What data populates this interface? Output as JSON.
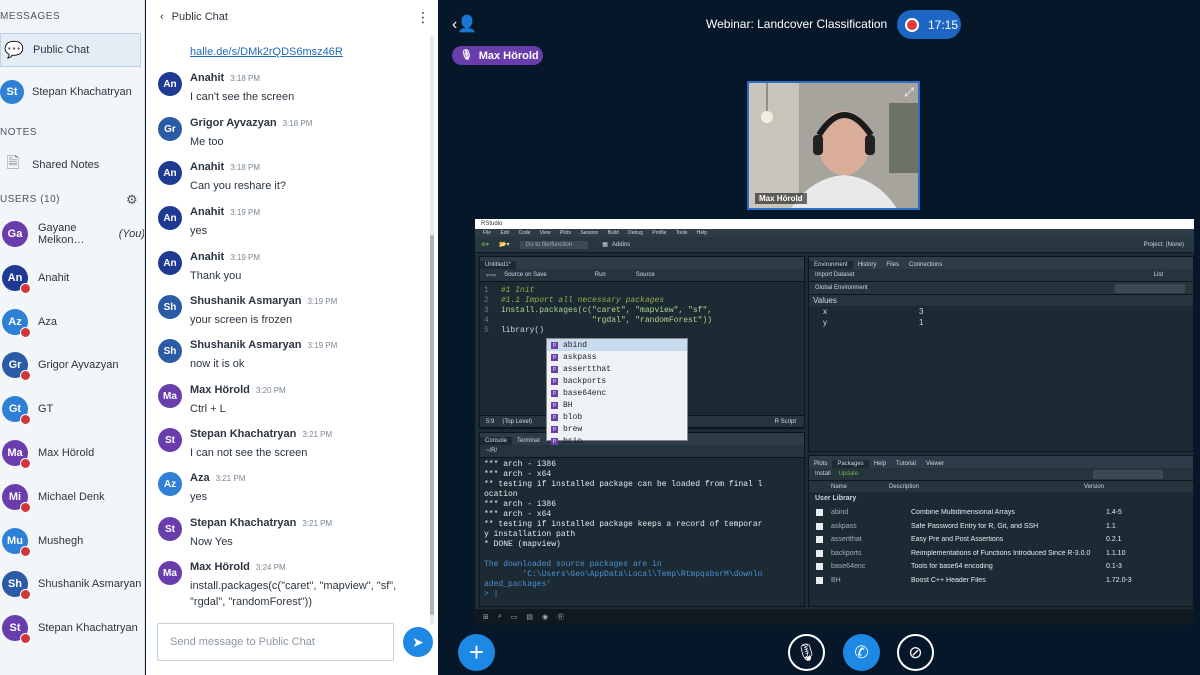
{
  "sidebar": {
    "messages_header": "MESSAGES",
    "public_chat": "Public Chat",
    "private_chat_initials": "St",
    "private_chat_name": "Stepan Khachatryan",
    "notes_header": "NOTES",
    "shared_notes": "Shared Notes",
    "users_header": "USERS (10)",
    "users": [
      {
        "initials": "Ga",
        "name": "Gayane Melkon…",
        "suffix": "(You)",
        "color": "#6a3dad"
      },
      {
        "initials": "An",
        "name": "Anahit",
        "suffix": "",
        "color": "#1f3a93"
      },
      {
        "initials": "Az",
        "name": "Aza",
        "suffix": "",
        "color": "#2e7fd6"
      },
      {
        "initials": "Gr",
        "name": "Grigor Ayvazyan",
        "suffix": "",
        "color": "#2b5aa6"
      },
      {
        "initials": "Gt",
        "name": "GT",
        "suffix": "",
        "color": "#2e7fd6"
      },
      {
        "initials": "Ma",
        "name": "Max Hörold",
        "suffix": "",
        "color": "#6a3dad"
      },
      {
        "initials": "Mi",
        "name": "Michael Denk",
        "suffix": "",
        "color": "#6a3dad"
      },
      {
        "initials": "Mu",
        "name": "Mushegh",
        "suffix": "",
        "color": "#2e7fd6"
      },
      {
        "initials": "Sh",
        "name": "Shushanik Asmaryan",
        "suffix": "",
        "color": "#2b5aa6"
      },
      {
        "initials": "St",
        "name": "Stepan Khachatryan",
        "suffix": "",
        "color": "#6a3dad"
      }
    ]
  },
  "chat": {
    "title": "Public Chat",
    "link": "halle.de/s/DMk2rQDS6msz46R",
    "messages": [
      {
        "initials": "An",
        "name": "Anahit",
        "time": "3:18 PM",
        "lines": [
          "I can't see the screen"
        ],
        "color": "#1f3a93"
      },
      {
        "initials": "Gr",
        "name": "Grigor Ayvazyan",
        "time": "3:18 PM",
        "lines": [
          "Me too"
        ],
        "color": "#2b5aa6"
      },
      {
        "initials": "An",
        "name": "Anahit",
        "time": "3:18 PM",
        "lines": [
          "Can you reshare it?"
        ],
        "color": "#1f3a93"
      },
      {
        "initials": "An",
        "name": "Anahit",
        "time": "3:19 PM",
        "lines": [
          "yes"
        ],
        "color": "#1f3a93"
      },
      {
        "initials": "An",
        "name": "Anahit",
        "time": "3:19 PM",
        "lines": [
          "Thank you"
        ],
        "color": "#1f3a93"
      },
      {
        "initials": "Sh",
        "name": "Shushanik Asmaryan",
        "time": "3:19 PM",
        "lines": [
          "your screen is frozen"
        ],
        "color": "#2b5aa6"
      },
      {
        "initials": "Sh",
        "name": "Shushanik Asmaryan",
        "time": "3:19 PM",
        "lines": [
          "now it is ok"
        ],
        "color": "#2b5aa6"
      },
      {
        "initials": "Ma",
        "name": "Max Hörold",
        "time": "3:20 PM",
        "lines": [
          "Ctrl + L"
        ],
        "color": "#6a3dad"
      },
      {
        "initials": "St",
        "name": "Stepan Khachatryan",
        "time": "3:21 PM",
        "lines": [
          "I can not see the screen"
        ],
        "color": "#6a3dad"
      },
      {
        "initials": "Az",
        "name": "Aza",
        "time": "3:21 PM",
        "lines": [
          "yes"
        ],
        "color": "#2e7fd6"
      },
      {
        "initials": "St",
        "name": "Stepan Khachatryan",
        "time": "3:21 PM",
        "lines": [
          "Now Yes"
        ],
        "color": "#6a3dad"
      },
      {
        "initials": "Ma",
        "name": "Max Hörold",
        "time": "3:24 PM",
        "lines": [
          "install.packages(c(\"caret\", \"mapview\", \"sf\",",
          "\"rgdal\", \"randomForest\"))"
        ],
        "color": "#6a3dad"
      }
    ],
    "input_placeholder": "Send message to Public Chat"
  },
  "stage": {
    "webinar_title": "Webinar: Landcover Classification",
    "recording_time": "17:15",
    "speaker": "Max Hörold",
    "camera_label": "Max Hörold"
  },
  "rstudio": {
    "window_title": "RStudio",
    "menu": "File Edit Code View Plots Session Build Debug Profile Tools Help",
    "goto": "Go to file/function",
    "addins": "Addins",
    "project": "Project: (None)",
    "editor_tab": "Untitled1*",
    "source_on_save": "Source on Save",
    "run": "Run",
    "source": "Source",
    "code": [
      {
        "n": "1",
        "text": "#1 Init",
        "cls": "cmt"
      },
      {
        "n": "2",
        "text": "#1.1 Import all necessary packages",
        "cls": "cmt"
      },
      {
        "n": "3",
        "text": "install.packages(c(\"caret\", \"mapview\", \"sf\",",
        "cls": "str"
      },
      {
        "n": "4",
        "text": "                   \"rgdal\", \"randomForest\"))",
        "cls": "str"
      },
      {
        "n": "5",
        "text": "library()",
        "cls": "fn"
      }
    ],
    "cursor_pos": "5:9",
    "top_level": "(Top Level)",
    "script_type": "R Script",
    "autocomplete": [
      "abind",
      "askpass",
      "assertthat",
      "backports",
      "base64enc",
      "BH",
      "blob",
      "brew",
      "brio"
    ],
    "console_tabs": [
      "Console",
      "Terminal"
    ],
    "console_path": "~/R/",
    "console": [
      {
        "text": "*** arch - i386",
        "cls": ""
      },
      {
        "text": "*** arch - x64",
        "cls": ""
      },
      {
        "text": "** testing if installed package can be loaded from final l",
        "cls": ""
      },
      {
        "text": "ocation",
        "cls": ""
      },
      {
        "text": "*** arch - i386",
        "cls": ""
      },
      {
        "text": "*** arch - x64",
        "cls": ""
      },
      {
        "text": "** testing if installed package keeps a record of temporar",
        "cls": ""
      },
      {
        "text": "y installation path",
        "cls": ""
      },
      {
        "text": "* DONE (mapview)",
        "cls": ""
      },
      {
        "text": "",
        "cls": ""
      },
      {
        "text": "The downloaded source packages are in",
        "cls": "blue"
      },
      {
        "text": "        'C:\\Users\\Geo\\AppData\\Local\\Temp\\RtmpqsbsrM\\downlo",
        "cls": "blue"
      },
      {
        "text": "aded_packages'",
        "cls": "blue"
      },
      {
        "text": "> |",
        "cls": "blue"
      }
    ],
    "env_tabs": [
      "Environment",
      "History",
      "Files",
      "Connections"
    ],
    "import_dataset": "Import Dataset",
    "list_label": "List",
    "global_env": "Global Environment",
    "values_header": "Values",
    "env_values": [
      {
        "name": "x",
        "value": "3"
      },
      {
        "name": "y",
        "value": "1"
      }
    ],
    "pkg_tabs": [
      "Plots",
      "Packages",
      "Help",
      "Tutorial",
      "Viewer"
    ],
    "install": "Install",
    "update": "Update",
    "pkg_cols": [
      "Name",
      "Description",
      "Version"
    ],
    "user_library": "User Library",
    "packages": [
      {
        "name": "abind",
        "desc": "Combine Multidimensional Arrays",
        "ver": "1.4-5"
      },
      {
        "name": "askpass",
        "desc": "Safe Password Entry for R, Git, and SSH",
        "ver": "1.1"
      },
      {
        "name": "assertthat",
        "desc": "Easy Pre and Post Assertions",
        "ver": "0.2.1"
      },
      {
        "name": "backports",
        "desc": "Reimplementations of Functions Introduced Since R-3.0.0",
        "ver": "1.1.10"
      },
      {
        "name": "base64enc",
        "desc": "Tools for base64 encoding",
        "ver": "0.1-3"
      },
      {
        "name": "BH",
        "desc": "Boost C++ Header Files",
        "ver": "1.72.0-3"
      }
    ]
  },
  "colors": {
    "stage_bg": "#06172a",
    "primary_blue": "#1e88e5",
    "presenter_purple": "#6a3dad",
    "mic_muted": "#d0363b"
  }
}
